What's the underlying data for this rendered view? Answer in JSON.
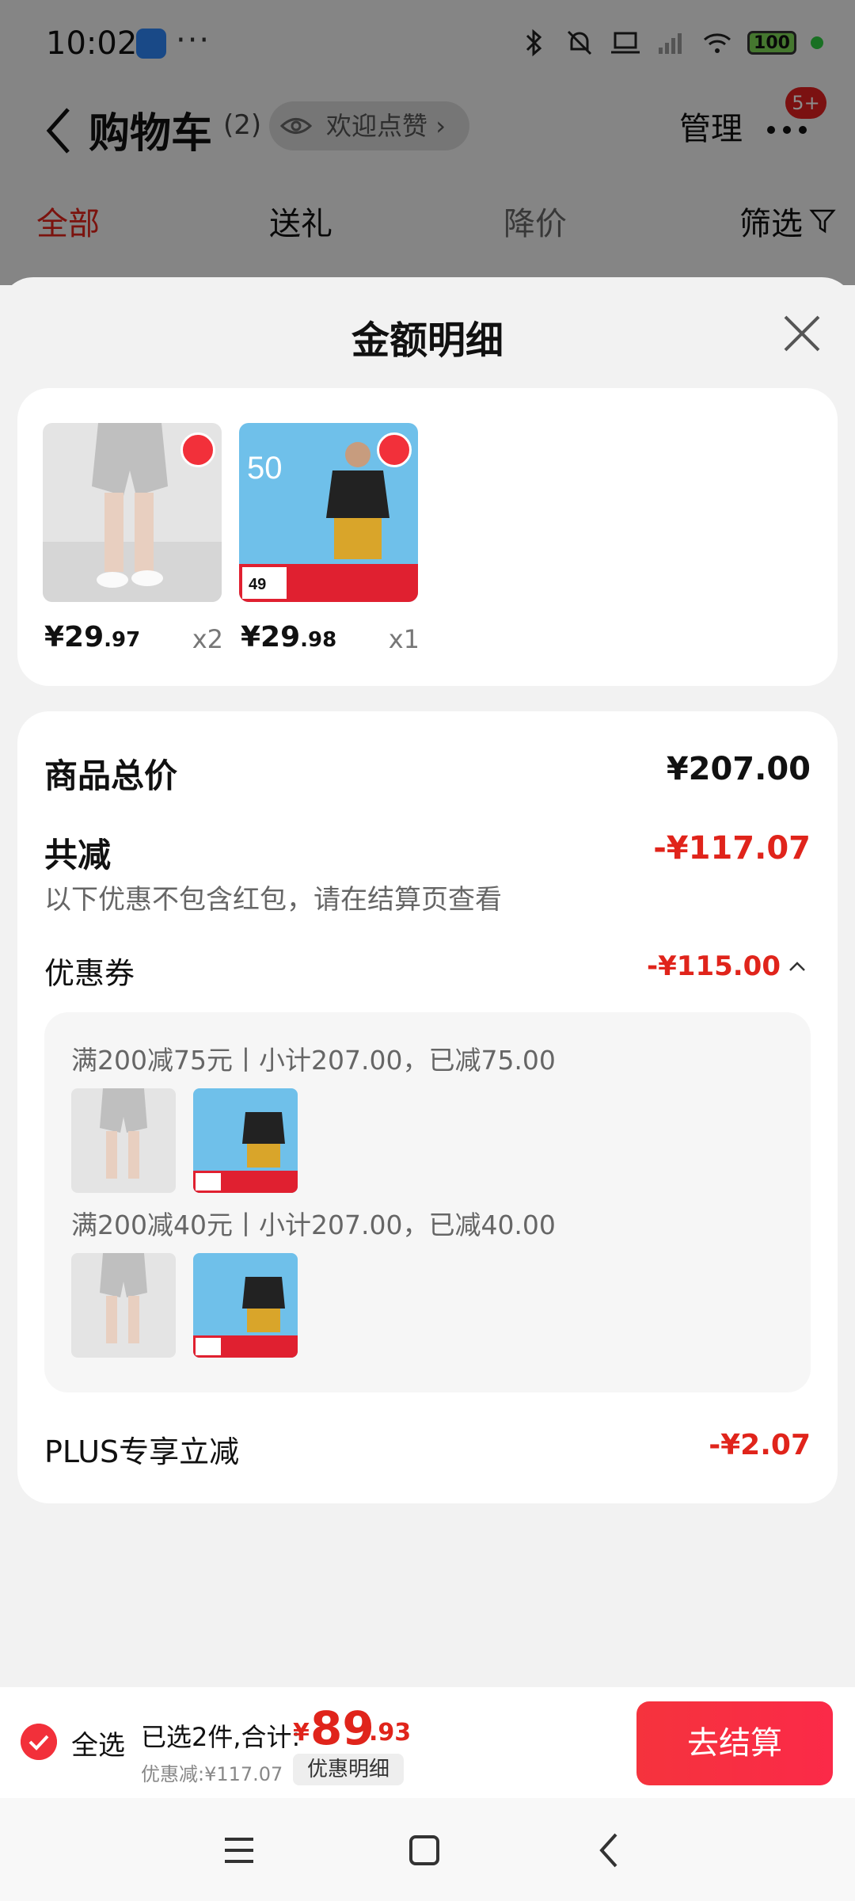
{
  "status_bar": {
    "time": "10:02",
    "dots": "···",
    "battery": "100"
  },
  "header": {
    "title": "购物车",
    "count": "(2)",
    "like_pill": "欢迎点赞",
    "manage": "管理",
    "notification_badge": "5+"
  },
  "tabs": [
    {
      "label": "全部"
    },
    {
      "label": "送礼"
    },
    {
      "label": "降价"
    },
    {
      "label": "筛选"
    }
  ],
  "sheet": {
    "title": "金额明细",
    "products": [
      {
        "price_int": "¥29",
        "price_dec": ".97",
        "qty": "x2"
      },
      {
        "price_int": "¥29",
        "price_dec": ".98",
        "qty": "x1"
      }
    ],
    "summary": {
      "total_label": "商品总价",
      "total_value": "¥207.00",
      "reduce_label": "共减",
      "reduce_value": "-¥117.07",
      "note": "以下优惠不包含红包，请在结算页查看",
      "coupon_label": "优惠券",
      "coupon_value": "-¥115.00",
      "coupons": [
        {
          "text": "满200减75元丨小计207.00，已减75.00"
        },
        {
          "text": "满200减40元丨小计207.00，已减40.00"
        }
      ],
      "plus_label": "PLUS专享立减",
      "plus_value": "-¥2.07"
    }
  },
  "bottom_bar": {
    "select_all": "全选",
    "picked": "已选2件,合计:",
    "total_symbol": "¥",
    "total_int": "89",
    "total_dec": ".93",
    "discount": "优惠减:¥117.07",
    "detail_button": "优惠明细",
    "checkout": "去结算"
  },
  "colors": {
    "accent": "#e0241b",
    "checkout_bg": "#f5333d"
  }
}
